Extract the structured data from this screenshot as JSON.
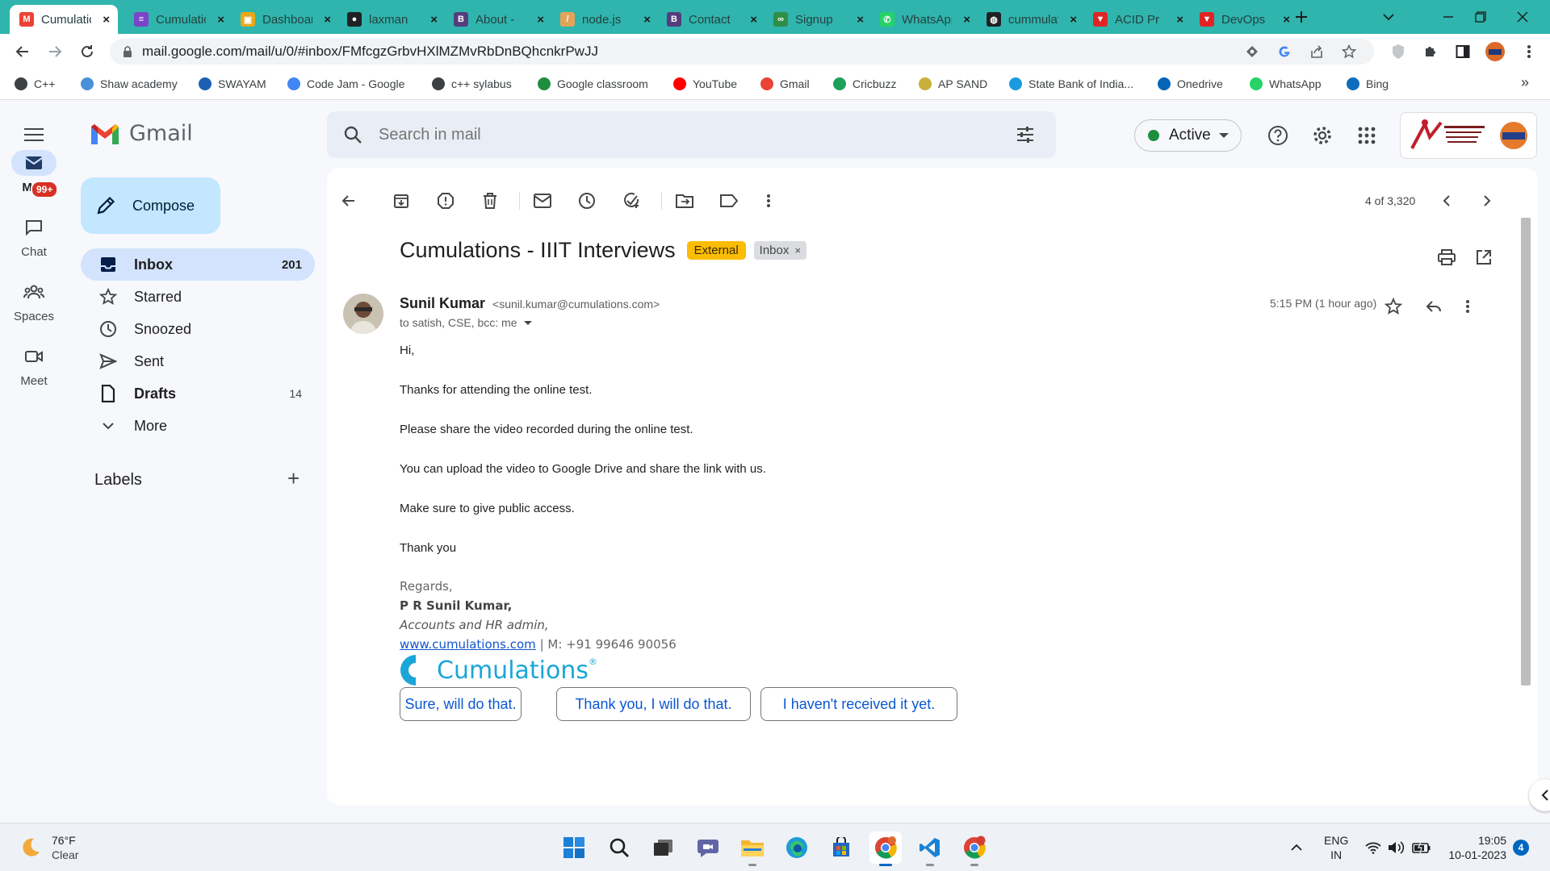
{
  "browser": {
    "tabs": [
      {
        "label": "Cumulations - IIIT",
        "color": "#ea4335",
        "glyph": "M",
        "active": true
      },
      {
        "label": "Cumulations",
        "color": "#7a45c8",
        "glyph": "≡"
      },
      {
        "label": "Dashboard",
        "color": "#e8a81a",
        "glyph": "▣"
      },
      {
        "label": "laxman",
        "color": "#202124",
        "glyph": "●"
      },
      {
        "label": "About -",
        "color": "#563d7c",
        "glyph": "B"
      },
      {
        "label": "node.js",
        "color": "#e3a45a",
        "glyph": "/"
      },
      {
        "label": "Contact",
        "color": "#563d7c",
        "glyph": "B"
      },
      {
        "label": "Signup",
        "color": "#2f8d46",
        "glyph": "∞"
      },
      {
        "label": "WhatsApp",
        "color": "#25d366",
        "glyph": "✆"
      },
      {
        "label": "cummulations",
        "color": "#202124",
        "glyph": "◍"
      },
      {
        "label": "ACID Pr",
        "color": "#e02424",
        "glyph": "▼"
      },
      {
        "label": "DevOps",
        "color": "#e02424",
        "glyph": "▼"
      }
    ],
    "url": "mail.google.com/mail/u/0/#inbox/FMfcgzGrbvHXlMZMvRbDnBQhcnkrPwJJ",
    "bookmarks": [
      {
        "label": "C++",
        "color": "#3c4043"
      },
      {
        "label": "Shaw academy",
        "color": "#4a90d9"
      },
      {
        "label": "SWAYAM",
        "color": "#1e5fb4"
      },
      {
        "label": "Code Jam - Google",
        "color": "#4285f4"
      },
      {
        "label": "c++ sylabus",
        "color": "#3c4043"
      },
      {
        "label": "Google classroom",
        "color": "#1e8e3e"
      },
      {
        "label": "YouTube",
        "color": "#ff0000"
      },
      {
        "label": "Gmail",
        "color": "#ea4335"
      },
      {
        "label": "Cricbuzz",
        "color": "#1ea05a"
      },
      {
        "label": "AP SAND",
        "color": "#c9b03a"
      },
      {
        "label": "State Bank of India...",
        "color": "#1a9be0"
      },
      {
        "label": "Onedrive",
        "color": "#0364b8"
      },
      {
        "label": "WhatsApp",
        "color": "#25d366"
      },
      {
        "label": "Bing",
        "color": "#0f6cbd"
      }
    ],
    "bookmarks_overflow": "»"
  },
  "gmail": {
    "app_name": "Gmail",
    "search_placeholder": "Search in mail",
    "status": "Active",
    "rail": [
      {
        "label": "Mail",
        "icon": "mail-icon"
      },
      {
        "label": "Chat",
        "icon": "chat-icon"
      },
      {
        "label": "Spaces",
        "icon": "spaces-icon"
      },
      {
        "label": "Meet",
        "icon": "meet-icon"
      }
    ],
    "mail_badge": "99+",
    "compose_label": "Compose",
    "nav": [
      {
        "label": "Inbox",
        "count": "201"
      },
      {
        "label": "Starred",
        "count": ""
      },
      {
        "label": "Snoozed",
        "count": ""
      },
      {
        "label": "Sent",
        "count": ""
      },
      {
        "label": "Drafts",
        "count": "14"
      },
      {
        "label": "More",
        "count": ""
      }
    ],
    "labels_heading": "Labels",
    "labels_add": "+",
    "counter": "4 of 3,320",
    "email": {
      "subject": "Cumulations - IIIT Interviews",
      "external_tag": "External",
      "inbox_tag": "Inbox",
      "sender_name": "Sunil Kumar",
      "sender_email": "<sunil.kumar@cumulations.com>",
      "recipients": "to satish, CSE, bcc: me",
      "time": "5:15 PM (1 hour ago)",
      "body": [
        "Hi,",
        "Thanks for attending the online test.",
        "Please share the video recorded during the online test.",
        "You can upload the video to Google Drive and share the link with us.",
        "Make sure to give public access.",
        "Thank you"
      ],
      "signature": {
        "regards": "Regards,",
        "name": "P R Sunil Kumar,",
        "title": "Accounts and HR admin,",
        "website": "www.cumulations.com",
        "phone": "| M: +91 99646 90056",
        "company": "Cumulations",
        "registered": "®"
      }
    },
    "smart_replies": [
      "Sure, will do that.",
      "Thank you, I will do that.",
      "I haven't received it yet."
    ]
  },
  "taskbar": {
    "weather_temp": "76°F",
    "weather_desc": "Clear",
    "language_top": "ENG",
    "language_bottom": "IN",
    "time": "19:05",
    "date": "10-01-2023",
    "notification_count": "4"
  }
}
